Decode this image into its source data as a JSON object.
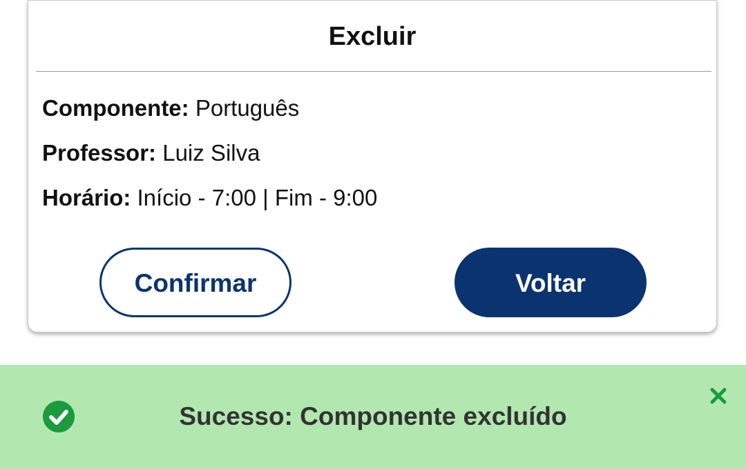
{
  "modal": {
    "title": "Excluir",
    "fields": [
      {
        "label": "Componente:",
        "value": " Português"
      },
      {
        "label": "Professor:",
        "value": " Luiz Silva"
      },
      {
        "label": "Horário:",
        "value": " Início - 7:00 | Fim - 9:00"
      }
    ],
    "confirm_label": "Confirmar",
    "back_label": "Voltar"
  },
  "toast": {
    "message": "Sucesso: Componente excluído",
    "icon": "check-circle-icon",
    "close_icon": "close-icon"
  },
  "colors": {
    "primary": "#0b3370",
    "toast_bg": "#b2e8b0",
    "success": "#1a9b3c"
  }
}
